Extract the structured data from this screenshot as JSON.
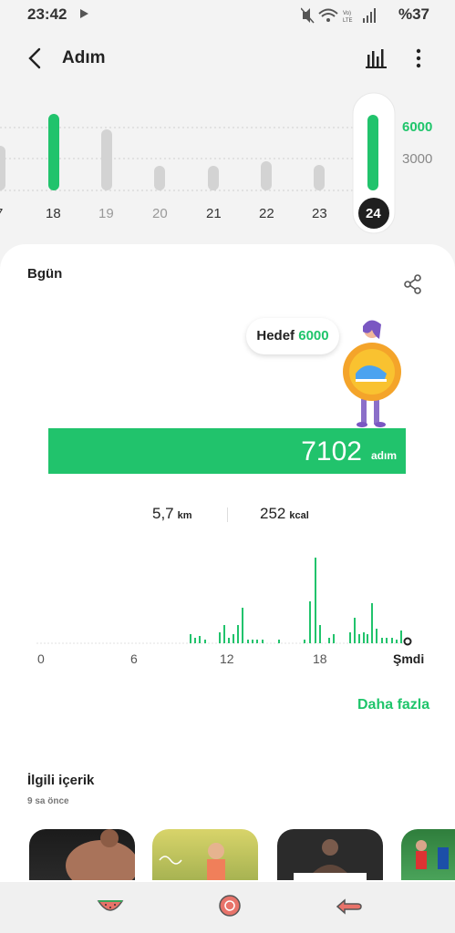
{
  "status_bar": {
    "time": "23:42",
    "battery": "%37"
  },
  "header": {
    "title": "Adım"
  },
  "week_chart": {
    "days": [
      "7",
      "18",
      "19",
      "20",
      "21",
      "22",
      "23",
      "24"
    ],
    "selected_day": "24",
    "goal_label": "6000",
    "ref_label": "3000"
  },
  "today": {
    "title": "Bgün",
    "goal_prefix": "Hedef",
    "goal_value": "6000",
    "steps_value": "7102",
    "steps_unit": "adım",
    "distance_value": "5,7",
    "distance_unit": "km",
    "calories_value": "252",
    "calories_unit": "kcal"
  },
  "hourly_chart": {
    "x_labels": [
      "0",
      "6",
      "12",
      "18",
      "Şmdi"
    ]
  },
  "more_link": "Daha fazla",
  "related": {
    "title": "İlgili içerik",
    "time": "9 sa önce"
  },
  "colors": {
    "accent": "#21c36c",
    "card_bg": "#ffffff",
    "page_bg": "#f3f3f3"
  },
  "icons": [
    "back-icon",
    "bar-chart-icon",
    "more-vertical-icon",
    "share-icon",
    "watermelon-icon",
    "circle-icon",
    "arrow-icon"
  ]
}
